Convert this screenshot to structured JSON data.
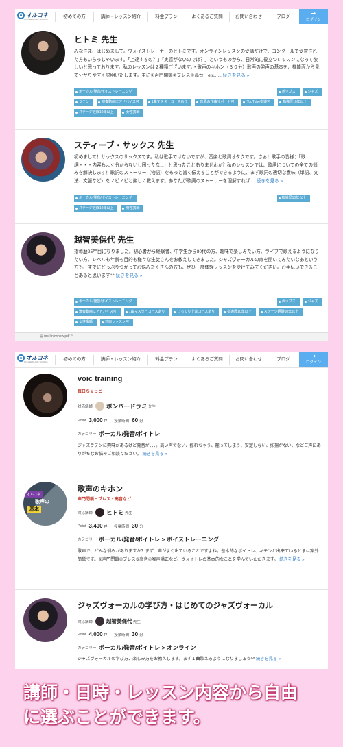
{
  "nav": {
    "logo": "オルコネ",
    "logo_sub": "ONLINE MUSIC SCHOOL",
    "items": [
      "初めての方",
      "講師・レッスン紹介",
      "料金プラン",
      "よくあるご質問",
      "お問い合わせ",
      "ブログ"
    ],
    "login": "ログイン"
  },
  "teachers": [
    {
      "name": "ヒトミ 先生",
      "desc": "みなさま、はじめまして。ヴォイストレーナーのヒトミです。オンラインレッスンの受講だけで、コンクールで受賞された方もいらっしゃいます。「上達するの？」「実感がないのでは？」というものから、日常的に役立つレッスンになって欲しいと思っております。私のレッスンは２種類ございます。・歌声のキホン（３０分）歌声の発声の基本を、機能面から見て分かりやすく説明いたします。主に①声門閉鎖②ブレス③高音　etc......",
      "more": "続きを見る »",
      "tags": [
        "ボーカル/発音/ボイストレーニング",
        "ポップス",
        "ジャズ",
        "ラテン",
        "演奏動画にアドバイス可",
        "1曲マスターコースあり",
        "音源の作曲サポート可",
        "YouTube指導可",
        "指導歴10年以上",
        "ステージ経験10年以上",
        "女性講師"
      ]
    },
    {
      "name": "スティーブ・サックス 先生",
      "desc": "初めまして！サックスのサックスです。私は歌手ではないですが、音楽と歌詞オタクです。さぁ！歌手の皆様：「歌詞・・・内容もよく分からないし困ったな...」と思ったことありませんか？私のレッスンでは、歌詞についての全ての悩みを解決します！歌詞のストーリー（物語）をもっと旨く伝えることができるように、まず歌詞の適切な意味（単語、文法、文脈など）をノビノビと楽しく教えます。あなたが歌詞のストーリーを理解すれば ...",
      "more": "続きを見る »",
      "tags": [
        "ボーカル/発音/ボイストレーニング",
        "指導歴10年以上",
        "ステージ経験10年以上",
        "男性講師"
      ]
    },
    {
      "name": "越智美保代 先生",
      "desc": "指導歴25年目になりました。初心者から経験者、中学生から80代の方、趣味で楽しみたい方、ライブで歌えるようになりたい方、レベルも年齢も目的も様々な生徒さんをお教えしてきました。ジャズヴォーカルの扉を開いてみたいなあという方も、すでにどっぷりつかってお悩みたくさんの方も、ぜひ一度体験レッスンを受けてみてください。お手伝いできることあると思います^^",
      "more": "続きを見る »",
      "tags": [
        "ボーカル/発音/ボイストレーニング",
        "ポップス",
        "ジャズ",
        "演奏動画にアドバイス可",
        "1曲マスターコースあり",
        "じっくり上達コースあり",
        "指導歴10年以上",
        "ステージ経験10年以上",
        "女性講師",
        "対面レッスン可"
      ]
    }
  ],
  "download_bar": "mc-knowhow.pdf",
  "lessons": [
    {
      "title": "voic training",
      "sub": "毎日ちょっと",
      "teacher_label": "対応講師",
      "teacher": "ボンバードラミ",
      "teacher_suffix": "先生",
      "point_label": "Point",
      "point": "3,000",
      "point_unit": "pt",
      "time_label": "授業時間",
      "time": "60",
      "time_unit": "分",
      "cat_label": "カテゴリー",
      "category": "ボーカル/発音/ボイトレ",
      "desc": "ジャズラテンに興味があるけど発音が、、、。高い声でない、掠れちゃう、籠ってしまう、安定しない、抑揚がない、などご声にありがちなお悩みご相談ください。",
      "more": "続きを見る »"
    },
    {
      "title": "歌声のキホン",
      "sub": "声門閉鎖・ブレス・高音など",
      "teacher_label": "対応講師",
      "teacher": "ヒトミ",
      "teacher_suffix": "先生",
      "point_label": "Point",
      "point": "3,400",
      "point_unit": "pt",
      "time_label": "授業時間",
      "time": "30",
      "time_unit": "分",
      "cat_label": "カテゴリー",
      "category": "ボーカル/発音/ボイトレ > ボイストレーニング",
      "desc": "歌声で、どんな悩みがありますか？まず、声がよく出ていることですよね。基本的なボイトレ、キチンと出来ているとまは案外簡単です。①声門閉鎖②ブレス③高音④喉声矯正など、ヴォイトレの基本的なことを学んでいただきます。",
      "more": "続きを見る »",
      "thumb": {
        "l1": "オルコネ",
        "l2": "歌声の",
        "l3": "基本"
      }
    },
    {
      "title": "ジャズヴォーカルの学び方・はじめてのジャズヴォーカル",
      "sub": "",
      "teacher_label": "対応講師",
      "teacher": "越智美保代",
      "teacher_suffix": "先生",
      "point_label": "Point",
      "point": "4,000",
      "point_unit": "pt",
      "time_label": "授業時間",
      "time": "30",
      "time_unit": "分",
      "cat_label": "カテゴリー",
      "category": "ボーカル/発音/ボイトレ > オンライン",
      "desc": "ジャズヴォーカルの学び方、楽しみ方をお教えします。まず１曲歌えるようになりましょう^^",
      "more": "続きを見る »"
    }
  ],
  "caption": {
    "line1": "講師・日時・レッスン内容から自由",
    "line2": "に選ぶことができます。"
  },
  "colors": {
    "background": "#fcd2ec",
    "tag": "#5aabd3",
    "login": "#5aaef0",
    "link": "#2a7ac5",
    "accent_red": "#c0392b"
  }
}
